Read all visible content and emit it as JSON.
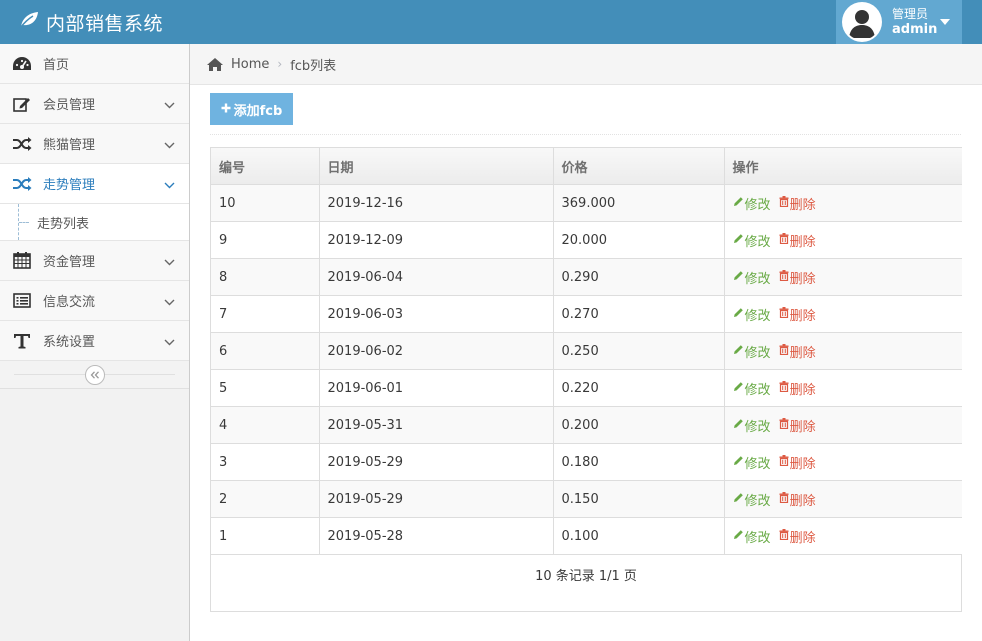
{
  "header": {
    "app_title": "内部销售系统",
    "user_role": "管理员",
    "user_name": "admin"
  },
  "sidebar": {
    "items": [
      {
        "label": "首页",
        "icon": "dashboard-icon"
      },
      {
        "label": "会员管理",
        "icon": "edit-icon"
      },
      {
        "label": "熊猫管理",
        "icon": "random-icon"
      },
      {
        "label": "走势管理",
        "icon": "random-icon",
        "active": true,
        "children": [
          {
            "label": "走势列表"
          }
        ]
      },
      {
        "label": "资金管理",
        "icon": "calendar-icon"
      },
      {
        "label": "信息交流",
        "icon": "list-alt-icon"
      },
      {
        "label": "系统设置",
        "icon": "text-icon"
      }
    ]
  },
  "breadcrumb": {
    "home": "Home",
    "current": "fcb列表"
  },
  "toolbar": {
    "add_label": "添加fcb"
  },
  "table": {
    "columns": [
      "编号",
      "日期",
      "价格",
      "操作"
    ],
    "edit_label": "修改",
    "delete_label": "删除",
    "rows": [
      {
        "id": "10",
        "date": "2019-12-16",
        "price": "369.000"
      },
      {
        "id": "9",
        "date": "2019-12-09",
        "price": "20.000"
      },
      {
        "id": "8",
        "date": "2019-06-04",
        "price": "0.290"
      },
      {
        "id": "7",
        "date": "2019-06-03",
        "price": "0.270"
      },
      {
        "id": "6",
        "date": "2019-06-02",
        "price": "0.250"
      },
      {
        "id": "5",
        "date": "2019-06-01",
        "price": "0.220"
      },
      {
        "id": "4",
        "date": "2019-05-31",
        "price": "0.200"
      },
      {
        "id": "3",
        "date": "2019-05-29",
        "price": "0.180"
      },
      {
        "id": "2",
        "date": "2019-05-29",
        "price": "0.150"
      },
      {
        "id": "1",
        "date": "2019-05-28",
        "price": "0.100"
      }
    ],
    "pager": "10 条记录 1/1 页"
  },
  "colors": {
    "navbar": "#438eb9",
    "user_menu": "#62a8d1",
    "active_nav": "#2b7dbc",
    "add_button": "#6fb3e0",
    "edit": "#69aa46",
    "delete": "#dd5a43"
  }
}
